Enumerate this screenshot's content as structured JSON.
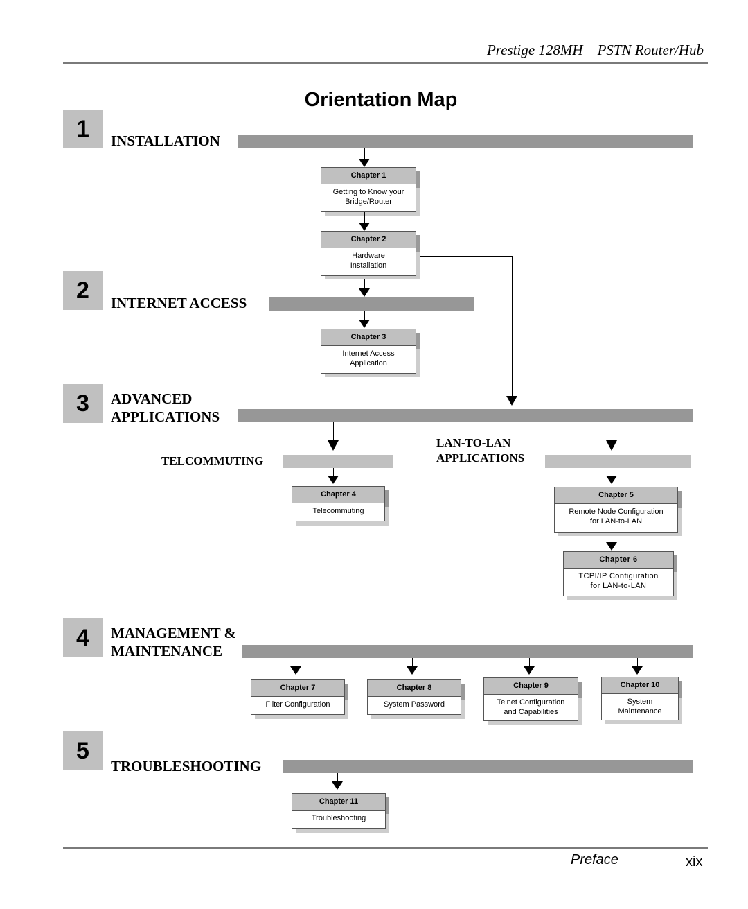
{
  "header": {
    "product": "Prestige 128MH",
    "subtitle": "PSTN Router/Hub"
  },
  "page_title": "Orientation Map",
  "sections": [
    {
      "number": "1",
      "label": "INSTALLATION"
    },
    {
      "number": "2",
      "label": "INTERNET ACCESS"
    },
    {
      "number": "3",
      "label_line1": "ADVANCED",
      "label_line2": "APPLICATIONS"
    },
    {
      "number": "4",
      "label_line1": "MANAGEMENT &",
      "label_line2": "MAINTENANCE"
    },
    {
      "number": "5",
      "label": "TROUBLESHOOTING"
    }
  ],
  "subsections": {
    "telecommuting": "TELCOMMUTING",
    "lan_line1": "LAN-TO-LAN",
    "lan_line2": "APPLICATIONS"
  },
  "chapters": [
    {
      "title": "Chapter 1",
      "desc": "Getting to Know your\nBridge/Router"
    },
    {
      "title": "Chapter 2",
      "desc": "Hardware\nInstallation"
    },
    {
      "title": "Chapter 3",
      "desc": "Internet Access\nApplication"
    },
    {
      "title": "Chapter 4",
      "desc": "Telecommuting"
    },
    {
      "title": "Chapter 5",
      "desc": "Remote Node Configuration\nfor LAN-to-LAN"
    },
    {
      "title": "Chapter 6",
      "desc": "TCPI/IP Configuration\nfor LAN-to-LAN"
    },
    {
      "title": "Chapter 7",
      "desc": "Filter Configuration"
    },
    {
      "title": "Chapter 8",
      "desc": "System Password"
    },
    {
      "title": "Chapter 9",
      "desc": "Telnet Configuration\nand Capabilities"
    },
    {
      "title": "Chapter 10",
      "desc": "System\nMaintenance"
    },
    {
      "title": "Chapter 11",
      "desc": "Troubleshooting"
    }
  ],
  "footer": {
    "section": "Preface",
    "page": "xix"
  }
}
